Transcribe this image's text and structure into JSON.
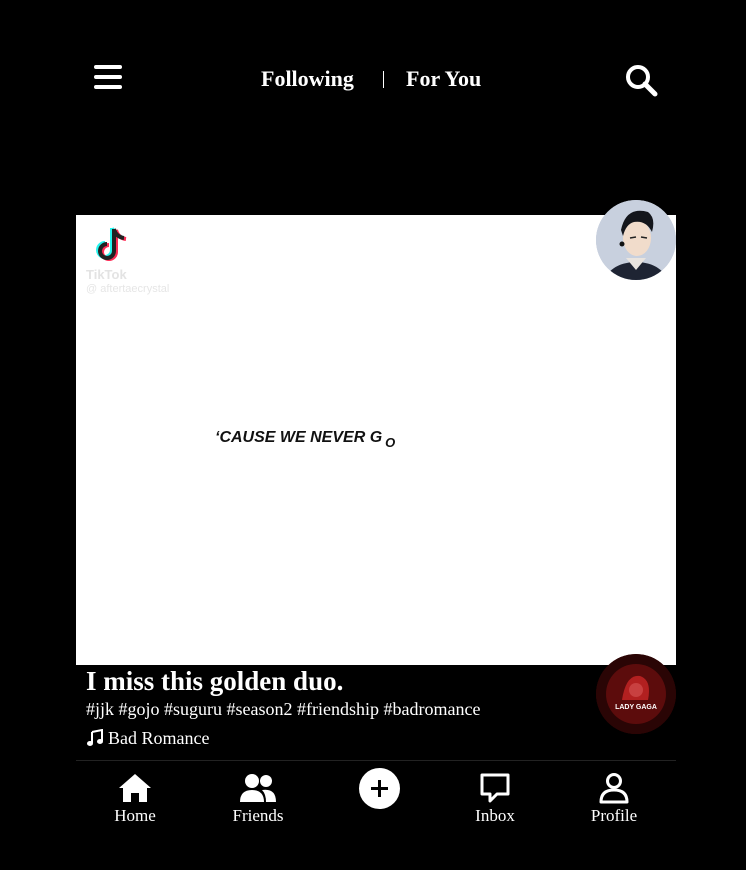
{
  "top_nav": {
    "menu_icon": "hamburger-menu-icon",
    "tab_following": "Following",
    "tab_foryou": "For You",
    "search_icon": "search-icon"
  },
  "video": {
    "watermark_brand": "TikTok",
    "watermark_handle": "@ aftertaecrystal",
    "caption_overlay": "‘CAUSE WE NEVER G",
    "caption_overlay_tail": "O",
    "background": "#ffffff"
  },
  "post": {
    "title": "I miss this golden duo.",
    "hashtags": "#jjk #gojo #suguru #season2 #friendship #badromance",
    "sound": "Bad Romance",
    "disc_label": "LADY GAGA"
  },
  "bottom_nav": {
    "home": "Home",
    "friends": "Friends",
    "create_icon": "plus-icon",
    "inbox": "Inbox",
    "profile": "Profile"
  },
  "colors": {
    "background": "#000000",
    "text": "#ffffff",
    "disc": "#3a0707"
  }
}
